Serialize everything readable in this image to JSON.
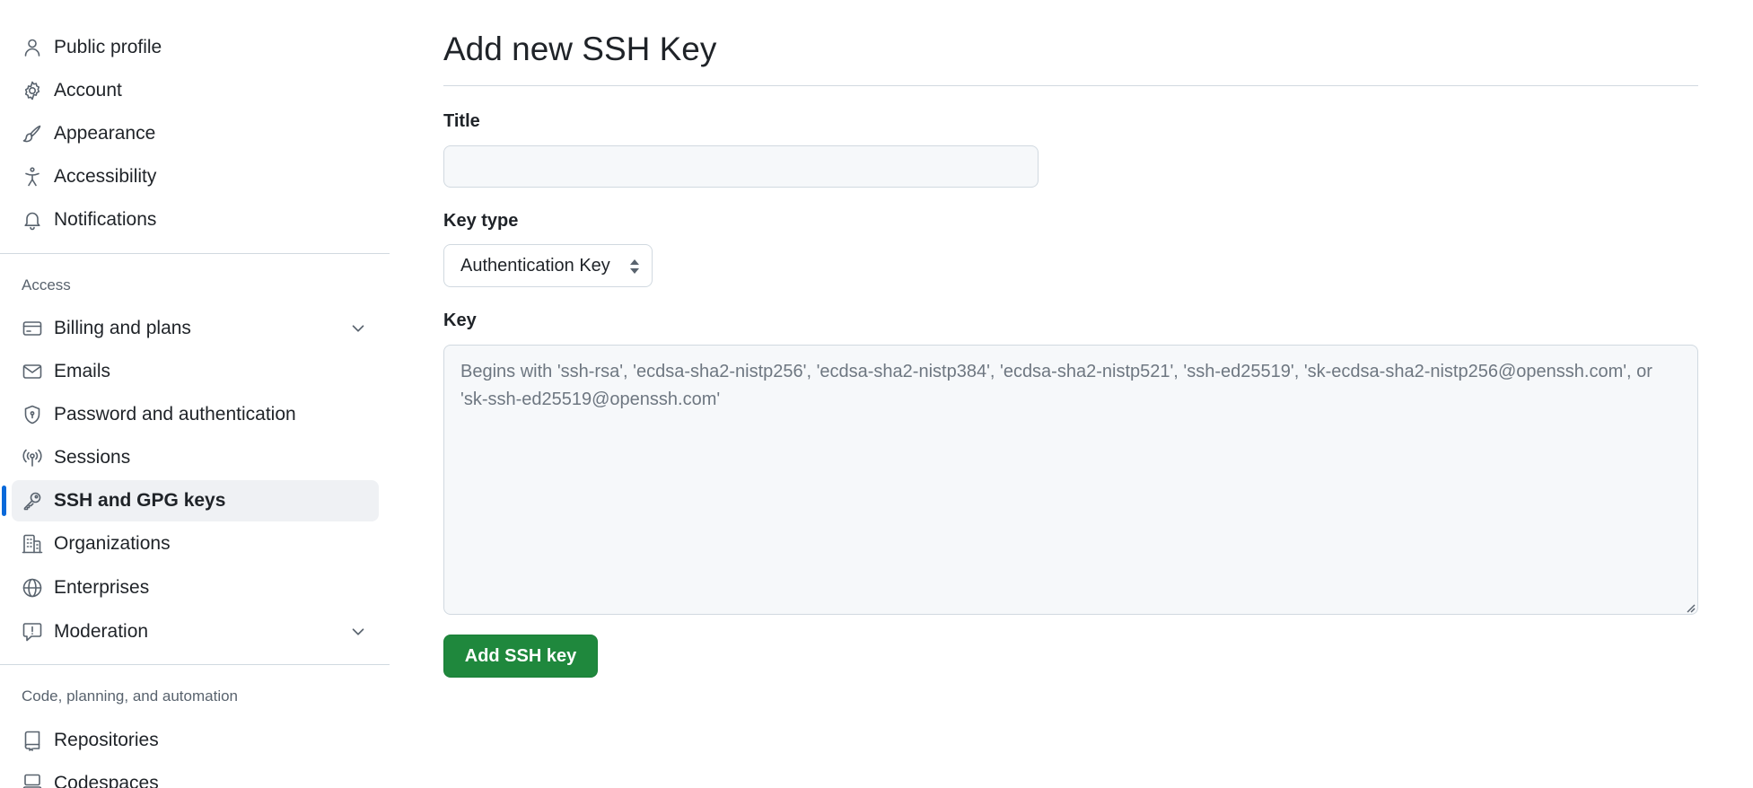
{
  "sidebar": {
    "group_top": [
      {
        "label": "Public profile",
        "icon": "person-icon"
      },
      {
        "label": "Account",
        "icon": "gear-icon"
      },
      {
        "label": "Appearance",
        "icon": "paintbrush-icon"
      },
      {
        "label": "Accessibility",
        "icon": "accessibility-icon"
      },
      {
        "label": "Notifications",
        "icon": "bell-icon"
      }
    ],
    "access_heading": "Access",
    "group_access": [
      {
        "label": "Billing and plans",
        "icon": "credit-card-icon",
        "expandable": true
      },
      {
        "label": "Emails",
        "icon": "mail-icon"
      },
      {
        "label": "Password and authentication",
        "icon": "shield-lock-icon"
      },
      {
        "label": "Sessions",
        "icon": "broadcast-icon"
      },
      {
        "label": "SSH and GPG keys",
        "icon": "key-icon",
        "active": true
      },
      {
        "label": "Organizations",
        "icon": "organization-icon"
      },
      {
        "label": "Enterprises",
        "icon": "globe-icon"
      },
      {
        "label": "Moderation",
        "icon": "report-icon",
        "expandable": true
      }
    ],
    "code_heading": "Code, planning, and automation",
    "group_code": [
      {
        "label": "Repositories",
        "icon": "repo-icon"
      },
      {
        "label": "Codespaces",
        "icon": "codespaces-icon"
      }
    ]
  },
  "main": {
    "title": "Add new SSH Key",
    "title_field": {
      "label": "Title",
      "value": "",
      "placeholder": ""
    },
    "key_type_field": {
      "label": "Key type",
      "selected": "Authentication Key"
    },
    "key_field": {
      "label": "Key",
      "value": "",
      "placeholder": "Begins with 'ssh-rsa', 'ecdsa-sha2-nistp256', 'ecdsa-sha2-nistp384', 'ecdsa-sha2-nistp521', 'ssh-ed25519', 'sk-ecdsa-sha2-nistp256@openssh.com', or 'sk-ssh-ed25519@openssh.com'"
    },
    "submit_label": "Add SSH key"
  },
  "colors": {
    "accent": "#0969da",
    "primary_button": "#1f883d",
    "active_nav_bg": "#eff1f4",
    "border": "#d1d9e0",
    "input_bg": "#f6f8fa",
    "muted_text": "#59636e"
  }
}
